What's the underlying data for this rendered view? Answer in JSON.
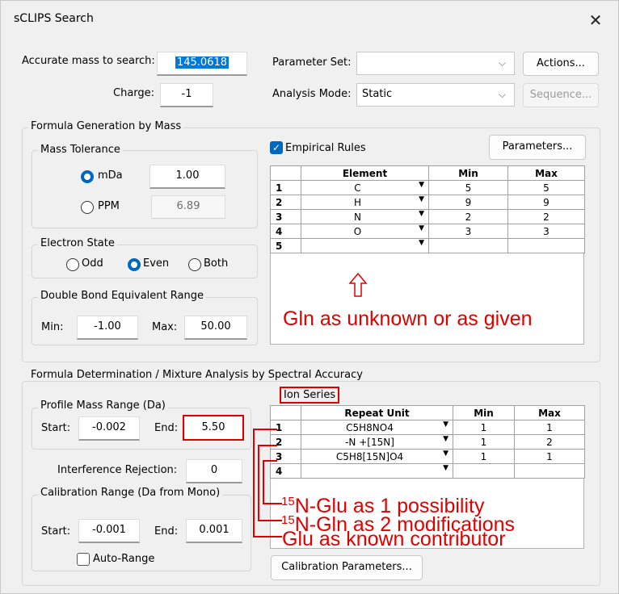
{
  "window": {
    "title": "sCLIPS Search"
  },
  "top": {
    "accurate_mass_label": "Accurate mass to search:",
    "accurate_mass_value": "145.0618",
    "charge_label": "Charge:",
    "charge_value": "-1",
    "parameter_set_label": "Parameter Set:",
    "parameter_set_value": "",
    "analysis_mode_label": "Analysis Mode:",
    "analysis_mode_value": "Static",
    "actions_button": "Actions...",
    "sequence_button": "Sequence..."
  },
  "formula_generation": {
    "title": "Formula Generation by Mass",
    "mass_tolerance": {
      "title": "Mass Tolerance",
      "mda_label": "mDa",
      "mda_value": "1.00",
      "ppm_label": "PPM",
      "ppm_value": "6.89",
      "selected": "mDa"
    },
    "electron_state": {
      "title": "Electron State",
      "odd": "Odd",
      "even": "Even",
      "both": "Both",
      "selected": "Even"
    },
    "dbe": {
      "title": "Double Bond Equivalent Range",
      "min_label": "Min:",
      "min_value": "-1.00",
      "max_label": "Max:",
      "max_value": "50.00"
    },
    "empirical_rules_label": "Empirical Rules",
    "empirical_rules_checked": true,
    "parameters_button": "Parameters...",
    "element_table": {
      "headers": [
        "",
        "Element",
        "Min",
        "Max"
      ],
      "rows": [
        {
          "n": "1",
          "element": "C",
          "min": "5",
          "max": "5"
        },
        {
          "n": "2",
          "element": "H",
          "min": "9",
          "max": "9"
        },
        {
          "n": "3",
          "element": "N",
          "min": "2",
          "max": "2"
        },
        {
          "n": "4",
          "element": "O",
          "min": "3",
          "max": "3"
        },
        {
          "n": "5",
          "element": "",
          "min": "",
          "max": ""
        }
      ]
    }
  },
  "formula_determination": {
    "title": "Formula Determination / Mixture Analysis by Spectral Accuracy",
    "profile": {
      "title": "Profile Mass Range (Da)",
      "start_label": "Start:",
      "start_value": "-0.002",
      "end_label": "End:",
      "end_value": "5.50"
    },
    "interference_label": "Interference Rejection:",
    "interference_value": "0",
    "calibration": {
      "title": "Calibration Range (Da from Mono)",
      "start_label": "Start:",
      "start_value": "-0.001",
      "end_label": "End:",
      "end_value": "0.001",
      "auto_range_label": "Auto-Range",
      "auto_range_checked": false
    },
    "ion_series_label": "Ion Series",
    "ion_table": {
      "headers": [
        "",
        "Repeat Unit",
        "Min",
        "Max"
      ],
      "rows": [
        {
          "n": "1",
          "unit": "C5H8NO4",
          "min": "1",
          "max": "1"
        },
        {
          "n": "2",
          "unit": "-N +[15N]",
          "min": "1",
          "max": "2"
        },
        {
          "n": "3",
          "unit": "C5H8[15N]O4",
          "min": "1",
          "max": "1"
        },
        {
          "n": "4",
          "unit": "",
          "min": "",
          "max": ""
        }
      ]
    },
    "calibration_parameters_button": "Calibration Parameters..."
  },
  "annotations": {
    "gln_note": "Gln as unknown or as given",
    "glu15_sup": "15",
    "glu15_text": "N-Glu as 1 possibility",
    "gln15_sup": "15",
    "gln15_text": "N-Gln as 2 modifications",
    "glu_known": "Glu as known contributor",
    "color": "#e00000"
  },
  "icons": {
    "close": "close-icon",
    "dropdown": "chevron-down-icon",
    "up_arrow": "up-arrow-icon",
    "check": "check-icon"
  }
}
